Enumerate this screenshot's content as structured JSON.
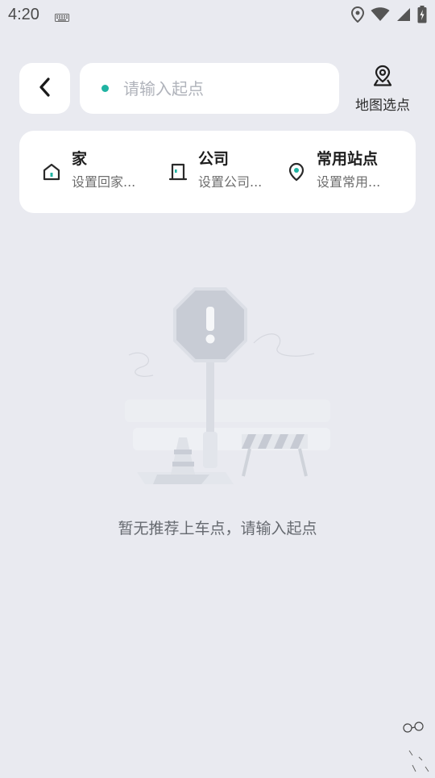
{
  "status_bar": {
    "time": "4:20",
    "icons": [
      "keyboard-icon",
      "location-icon",
      "wifi-icon",
      "signal-icon",
      "battery-icon"
    ]
  },
  "search": {
    "placeholder": "请输入起点",
    "value": "",
    "dot_color": "#1fb3a2"
  },
  "map_pick": {
    "label": "地图选点",
    "icon": "map-pin-icon"
  },
  "quick_places": [
    {
      "title": "家",
      "subtitle": "设置回家...",
      "icon": "home-icon"
    },
    {
      "title": "公司",
      "subtitle": "设置公司...",
      "icon": "office-door-icon"
    },
    {
      "title": "常用站点",
      "subtitle": "设置常用...",
      "icon": "location-pin-icon"
    }
  ],
  "empty_state": {
    "message": "暂无推荐上车点，请输入起点",
    "illustration": "stop-sign-roadblock-illustration"
  },
  "colors": {
    "background": "#e9eaf0",
    "card": "#ffffff",
    "accent": "#1fb3a2"
  }
}
